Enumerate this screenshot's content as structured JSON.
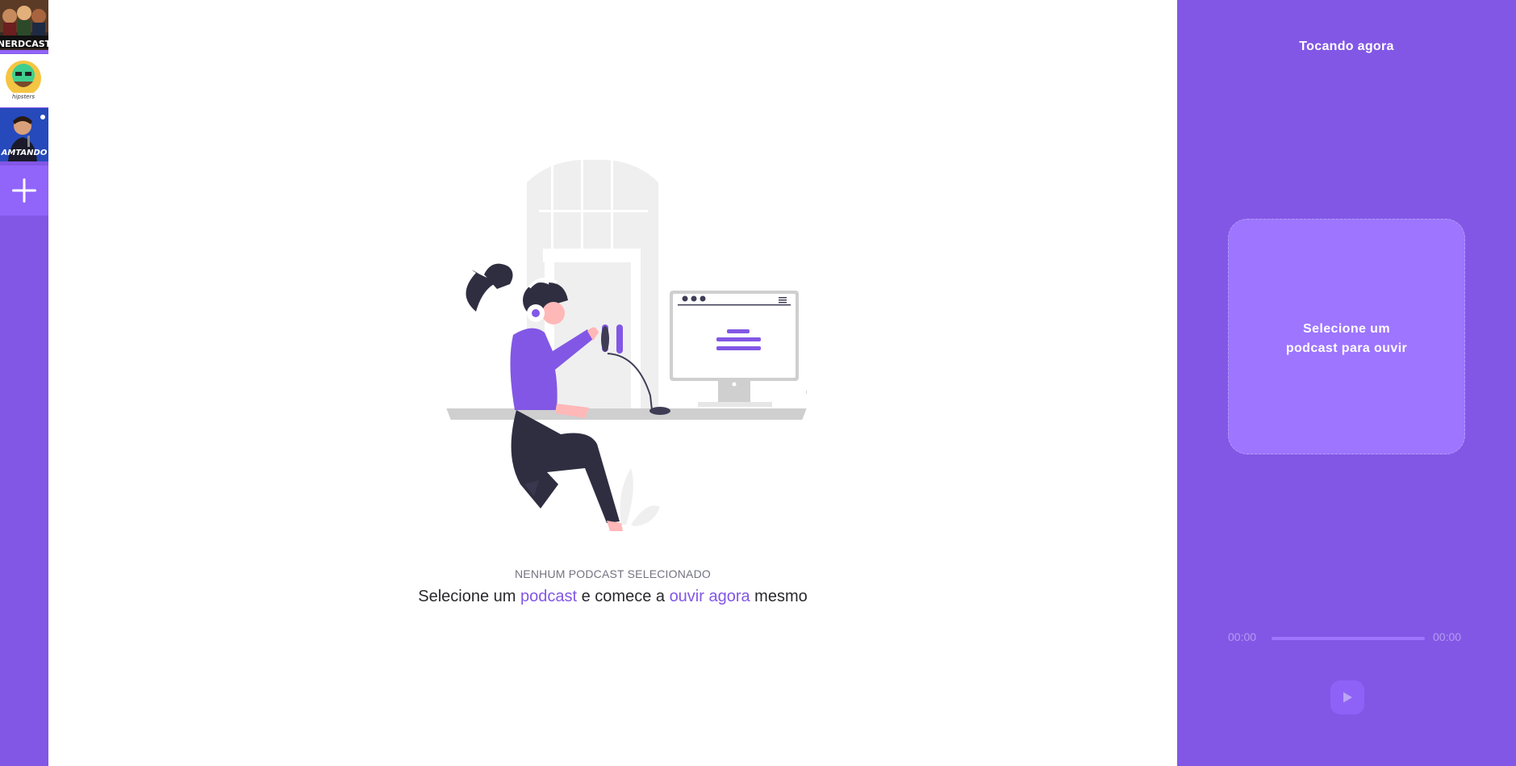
{
  "sidebar": {
    "podcasts": [
      {
        "name": "NERDCAST",
        "icon": "nerdcast-cover"
      },
      {
        "name": "",
        "icon": "hipsters-cover"
      },
      {
        "name": "AMTANDO",
        "icon": "comedian-cover"
      }
    ],
    "add_icon": "plus-icon"
  },
  "main": {
    "empty_caption": "NENHUM PODCAST SELECIONADO",
    "empty_text": {
      "part1": "Selecione um ",
      "link1": "podcast",
      "part2": " e comece a ",
      "link2": "ouvir agora",
      "part3": " mesmo"
    }
  },
  "player": {
    "title": "Tocando agora",
    "empty_text": "Selecione um podcast para ouvir",
    "time_current": "00:00",
    "time_total": "00:00",
    "progress": 0,
    "play_icon": "play-icon"
  },
  "colors": {
    "primary": "#8257e5",
    "primary_light": "#9d75ff",
    "text": "#29292e",
    "muted": "#737380"
  }
}
